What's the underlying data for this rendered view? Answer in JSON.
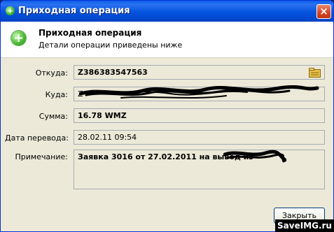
{
  "window": {
    "title": "Приходная операция",
    "close_glyph": "×"
  },
  "header": {
    "title": "Приходная операция",
    "subtitle": "Детали операции приведены ниже",
    "icon": "plus-circle-icon"
  },
  "fields": {
    "from_label": "Откуда:",
    "from_value": "Z386383547563",
    "to_label": "Куда:",
    "to_value": "Z",
    "amount_label": "Сумма:",
    "amount_value": "16.78 WMZ",
    "date_label": "Дата перевода:",
    "date_value": "28.02.11 09:54",
    "note_label": "Примечание:",
    "note_value": "Заявка 3016 от 27.02.2011 на вывод из"
  },
  "buttons": {
    "close_label": "Закрыть"
  },
  "watermark": {
    "text": "SaveIMG.ru"
  },
  "colors": {
    "titlebar": "#0453dd",
    "window_bg": "#ece9d8",
    "accent_green": "#4dbd35",
    "close_red": "#d7421f"
  }
}
